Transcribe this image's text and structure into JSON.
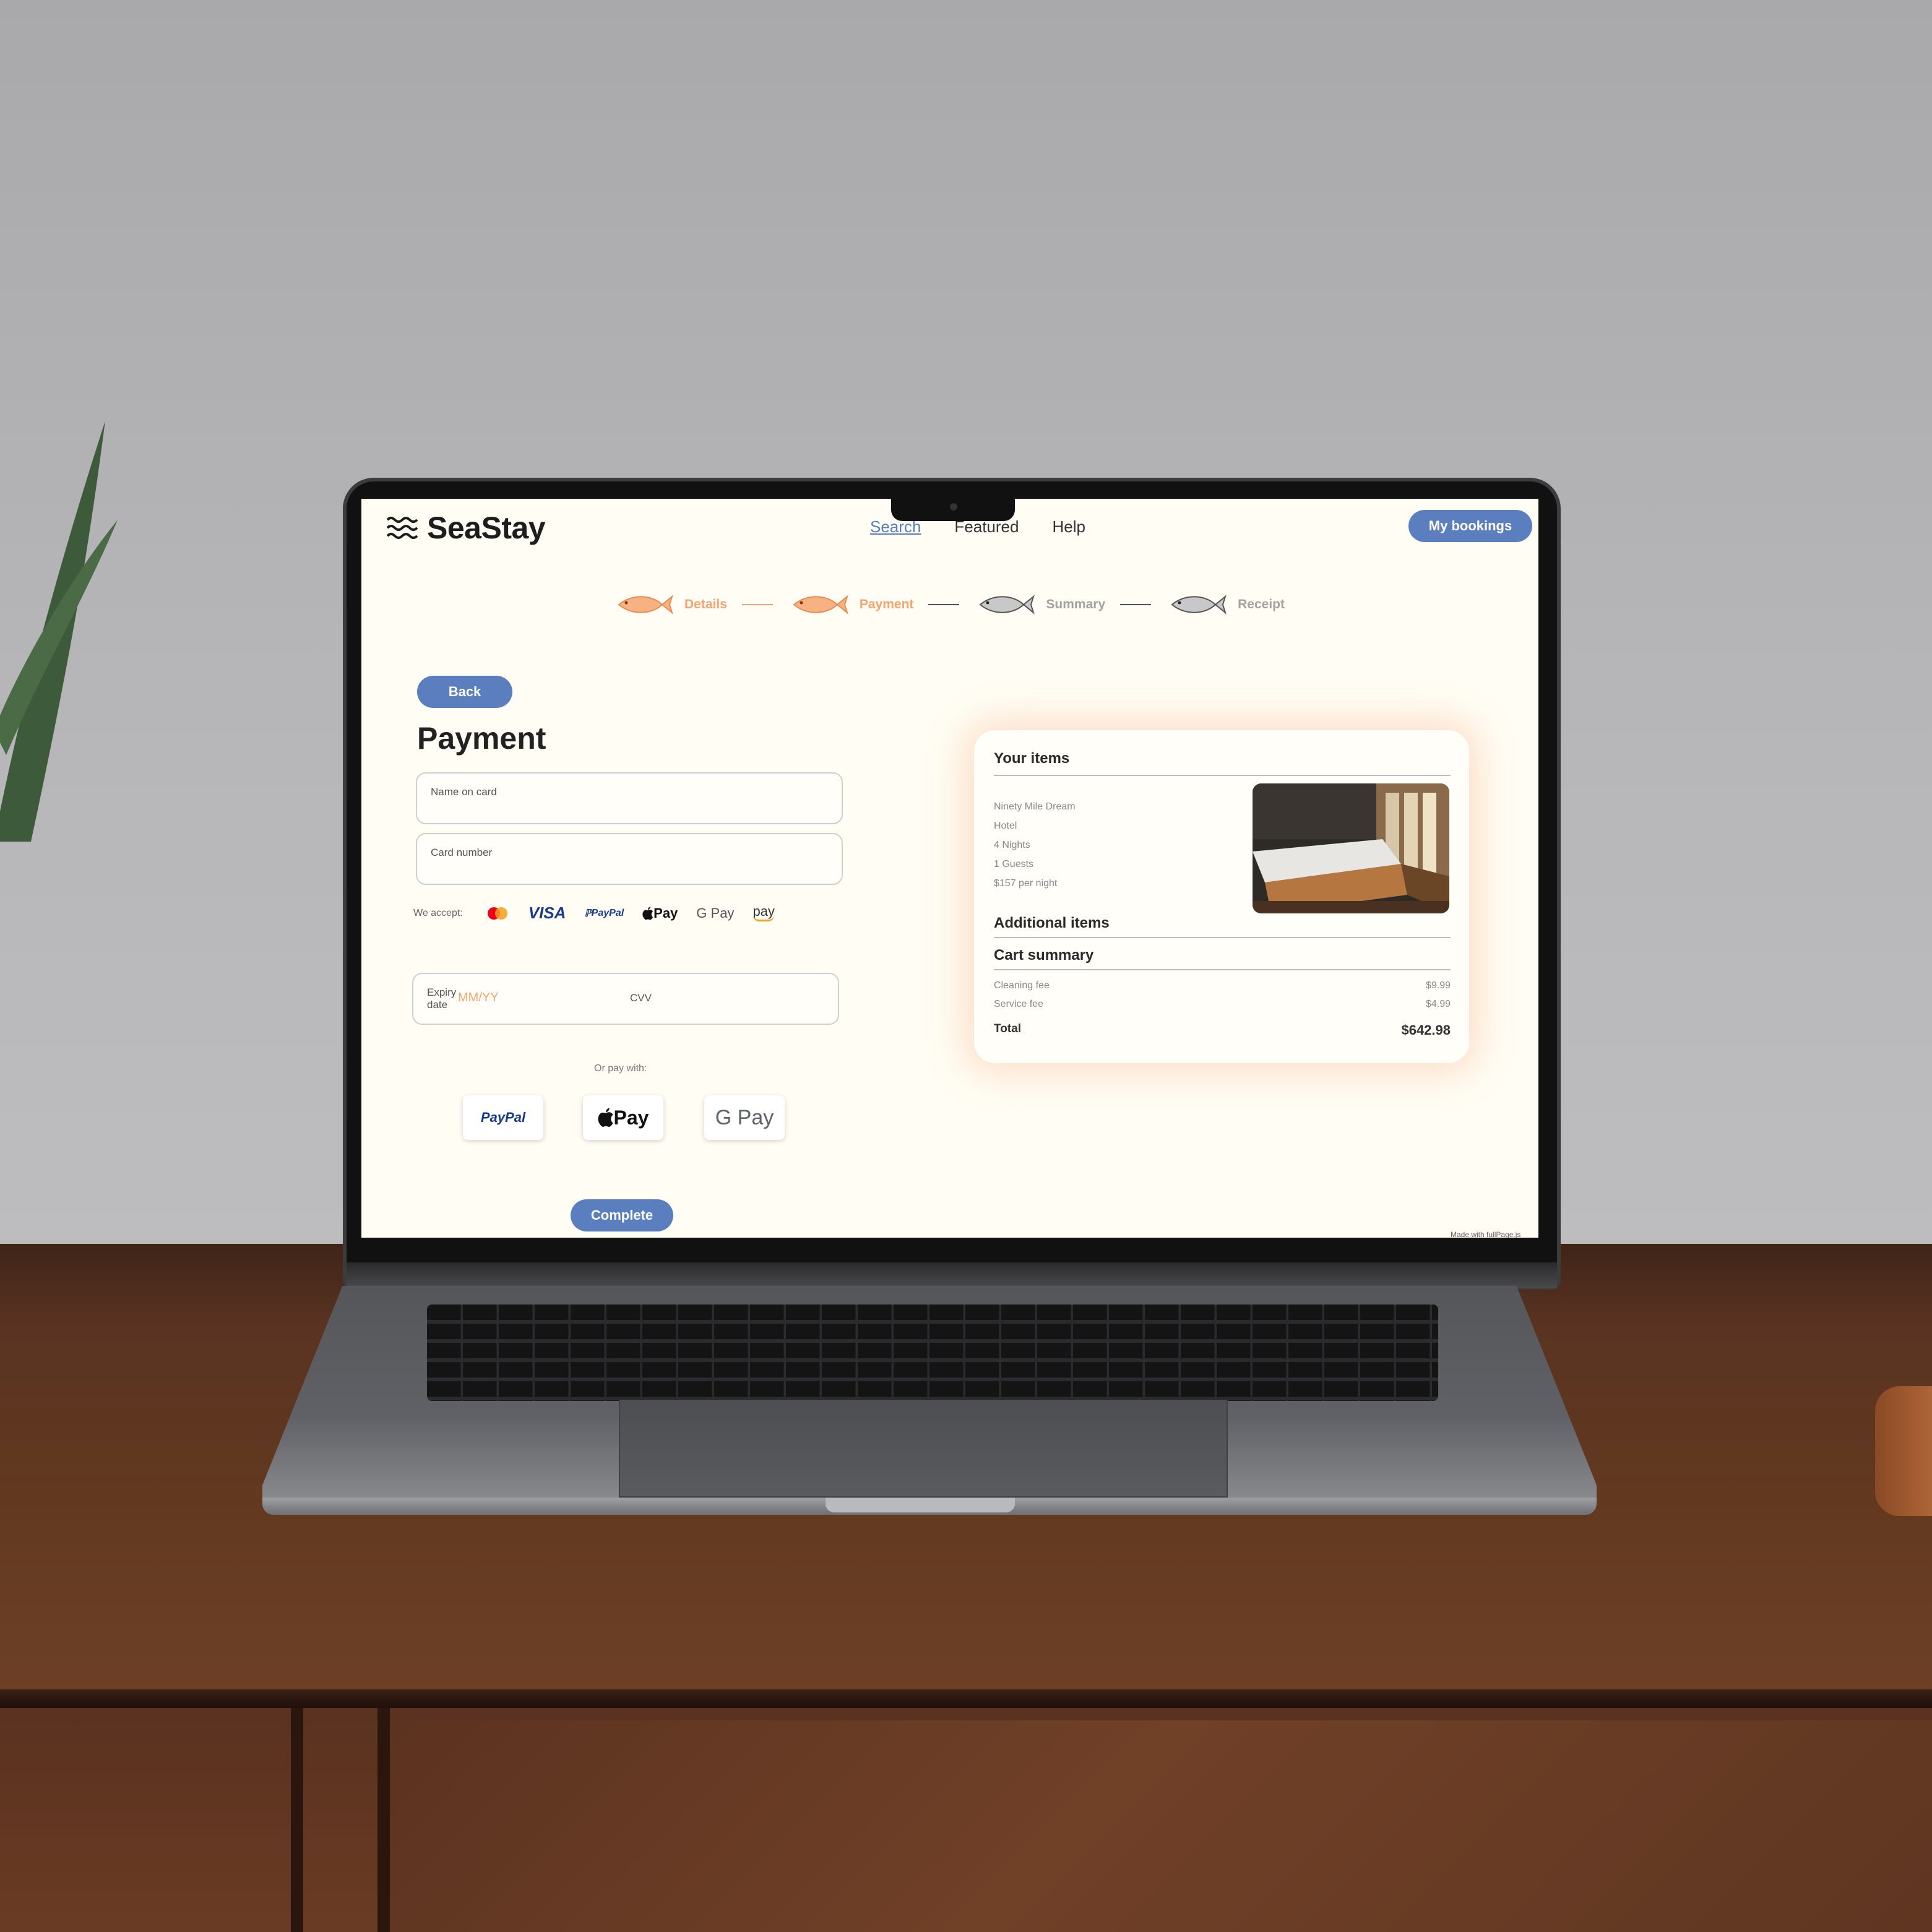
{
  "brand": {
    "name": "SeaStay"
  },
  "nav": {
    "items": [
      "Search",
      "Featured",
      "Help"
    ],
    "active": "Search",
    "bookings_label": "My bookings"
  },
  "steps": [
    {
      "label": "Details",
      "state": "done"
    },
    {
      "label": "Payment",
      "state": "done"
    },
    {
      "label": "Summary",
      "state": "todo"
    },
    {
      "label": "Receipt",
      "state": "todo"
    }
  ],
  "back_label": "Back",
  "title": "Payment",
  "form": {
    "name_label": "Name on card",
    "card_label": "Card number",
    "accept_label": "We accept:",
    "accepted_methods": [
      "mastercard-icon",
      "VISA",
      "PayPal",
      "Pay",
      "G Pay",
      "pay"
    ],
    "expiry_label": "Expiry date",
    "expiry_placeholder": "MM/YY",
    "cvv_label": "CVV",
    "or_pay_with": "Or pay with:",
    "alt_methods": {
      "paypal": "PayPal",
      "apple": "Pay",
      "google": "G Pay"
    },
    "complete_label": "Complete"
  },
  "summary": {
    "items_title": "Your items",
    "item_lines": [
      "Ninety Mile Dream",
      "Hotel",
      "4 Nights",
      "1 Guests",
      "$157 per night"
    ],
    "additional_title": "Additional items",
    "cart_title": "Cart summary",
    "fees": [
      {
        "label": "Cleaning fee",
        "amount": "$9.99"
      },
      {
        "label": "Service fee",
        "amount": "$4.99"
      }
    ],
    "total_label": "Total",
    "total_amount": "$642.98"
  },
  "watermark": "Made with fullPage.js",
  "colors": {
    "accent": "#5b7fbe",
    "highlight": "#f4a46e",
    "screen_bg": "#fffdf4"
  }
}
